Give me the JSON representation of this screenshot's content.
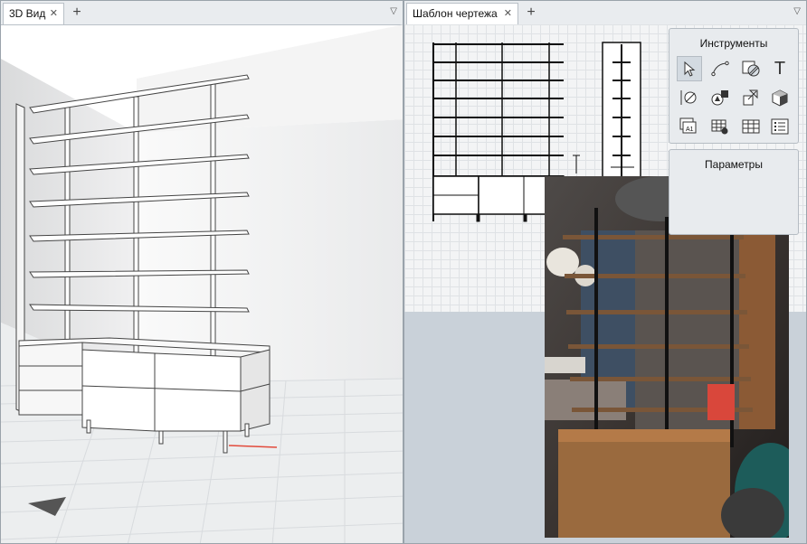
{
  "left_panel": {
    "tab_label": "3D Вид",
    "close_glyph": "✕",
    "add_glyph": "+",
    "menu_glyph": "▽"
  },
  "right_panel": {
    "tab_label": "Шаблон чертежа",
    "close_glyph": "✕",
    "add_glyph": "+",
    "menu_glyph": "▽",
    "tools_title": "Инструменты",
    "tools": [
      "select-cursor-icon",
      "curve-line-icon",
      "hatch-fill-icon",
      "text-icon",
      "dimension-icon",
      "shapes-icon",
      "export-box-icon",
      "3d-box-icon",
      "sheet-a1-icon",
      "table-settings-icon",
      "table-icon",
      "list-icon"
    ],
    "tools_t_glyph": "T",
    "tools_a1_glyph": "A1",
    "params_title": "Параметры"
  },
  "colors": {
    "accent": "#e24a3b",
    "panel_border": "#9aa3ab",
    "toolbox_bg": "#e8ebee"
  }
}
